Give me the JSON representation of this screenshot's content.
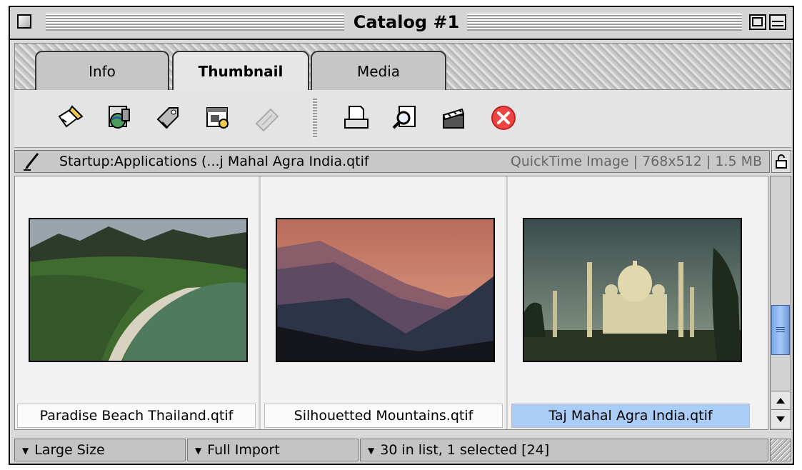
{
  "window": {
    "title": "Catalog #1"
  },
  "tabs": [
    {
      "label": "Info",
      "active": false
    },
    {
      "label": "Thumbnail",
      "active": true
    },
    {
      "label": "Media",
      "active": false
    }
  ],
  "toolbar": {
    "icons": [
      "edit-icon",
      "globe-search-icon",
      "tag-icon",
      "form-icon",
      "filmstrip-icon",
      "print-icon",
      "magnify-icon",
      "clapper-icon",
      "delete-icon"
    ]
  },
  "pathbar": {
    "path": "Startup:Applications (...j Mahal Agra India.qtif",
    "info": "QuickTime Image  |  768x512  |  1.5 MB"
  },
  "thumbnails": [
    {
      "name": "Paradise Beach Thailand.qtif",
      "selected": false
    },
    {
      "name": "Silhouetted Mountains.qtif",
      "selected": false
    },
    {
      "name": "Taj Mahal Agra India.qtif",
      "selected": true
    }
  ],
  "status": {
    "size": "Large Size",
    "import": "Full Import",
    "count": "30 in list, 1 selected [24]"
  },
  "colors": {
    "selection": "#a9cdf7",
    "scroll_thumb": "#7aa6e8",
    "delete_red": "#e44"
  }
}
